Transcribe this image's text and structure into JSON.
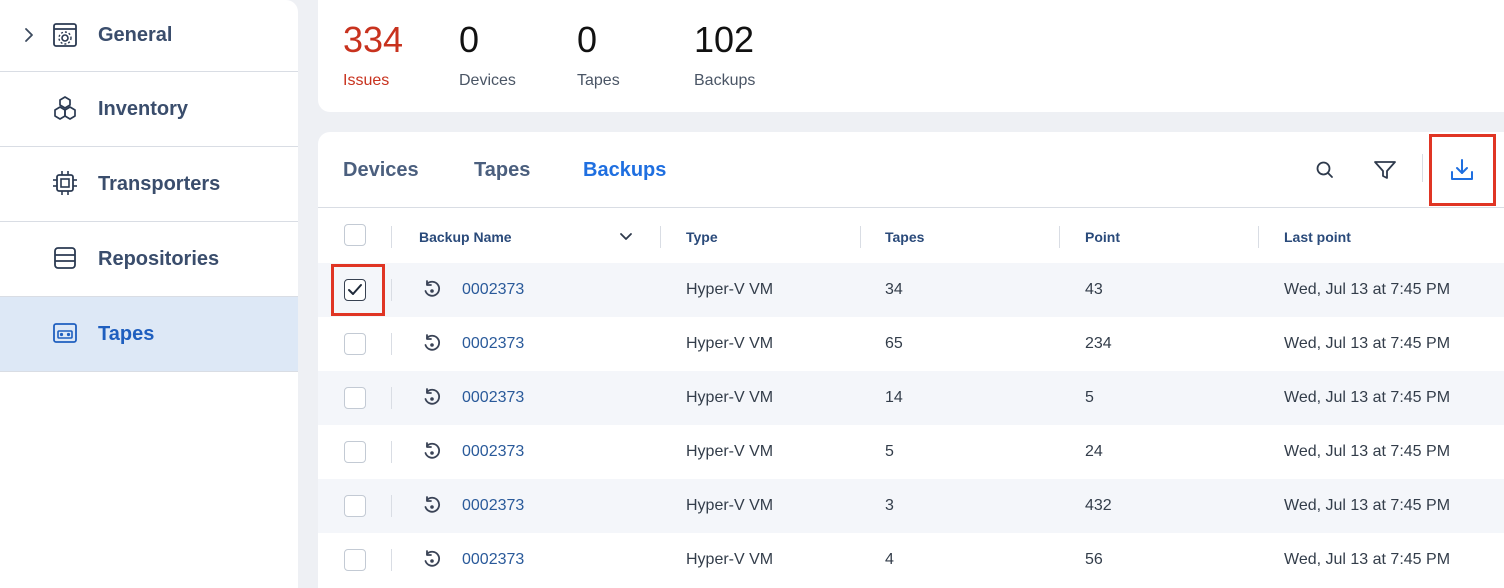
{
  "sidebar": {
    "items": [
      {
        "label": "General",
        "icon": "general-settings-icon",
        "expandable": true
      },
      {
        "label": "Inventory",
        "icon": "cubes-icon"
      },
      {
        "label": "Transporters",
        "icon": "chip-icon"
      },
      {
        "label": "Repositories",
        "icon": "database-icon"
      },
      {
        "label": "Tapes",
        "icon": "tape-icon",
        "active": true
      }
    ]
  },
  "stats": [
    {
      "value": "334",
      "label": "Issues",
      "color": "#c8321e"
    },
    {
      "value": "0",
      "label": "Devices"
    },
    {
      "value": "0",
      "label": "Tapes"
    },
    {
      "value": "102",
      "label": "Backups"
    }
  ],
  "tabs": [
    {
      "label": "Devices"
    },
    {
      "label": "Tapes"
    },
    {
      "label": "Backups",
      "active": true
    }
  ],
  "toolbar": {
    "search_icon": "search-icon",
    "filter_icon": "filter-icon",
    "export_icon": "download-icon"
  },
  "table": {
    "columns": [
      "Backup Name",
      "Type",
      "Tapes",
      "Point",
      "Last point"
    ],
    "rows": [
      {
        "checked": true,
        "name": "0002373",
        "type": "Hyper-V VM",
        "tapes": "34",
        "point": "43",
        "last_point": "Wed, Jul 13 at 7:45 PM"
      },
      {
        "checked": false,
        "name": "0002373",
        "type": "Hyper-V VM",
        "tapes": "65",
        "point": "234",
        "last_point": "Wed, Jul 13 at 7:45 PM"
      },
      {
        "checked": false,
        "name": "0002373",
        "type": "Hyper-V VM",
        "tapes": "14",
        "point": "5",
        "last_point": "Wed, Jul 13 at 7:45 PM"
      },
      {
        "checked": false,
        "name": "0002373",
        "type": "Hyper-V VM",
        "tapes": "5",
        "point": "24",
        "last_point": "Wed, Jul 13 at 7:45 PM"
      },
      {
        "checked": false,
        "name": "0002373",
        "type": "Hyper-V VM",
        "tapes": "3",
        "point": "432",
        "last_point": "Wed, Jul 13 at 7:45 PM"
      },
      {
        "checked": false,
        "name": "0002373",
        "type": "Hyper-V VM",
        "tapes": "4",
        "point": "56",
        "last_point": "Wed, Jul 13 at 7:45 PM"
      }
    ]
  },
  "colors": {
    "accent": "#1f6fe0",
    "issues": "#c8321e",
    "highlight": "#e03524",
    "active_nav_bg": "#dde8f6"
  }
}
